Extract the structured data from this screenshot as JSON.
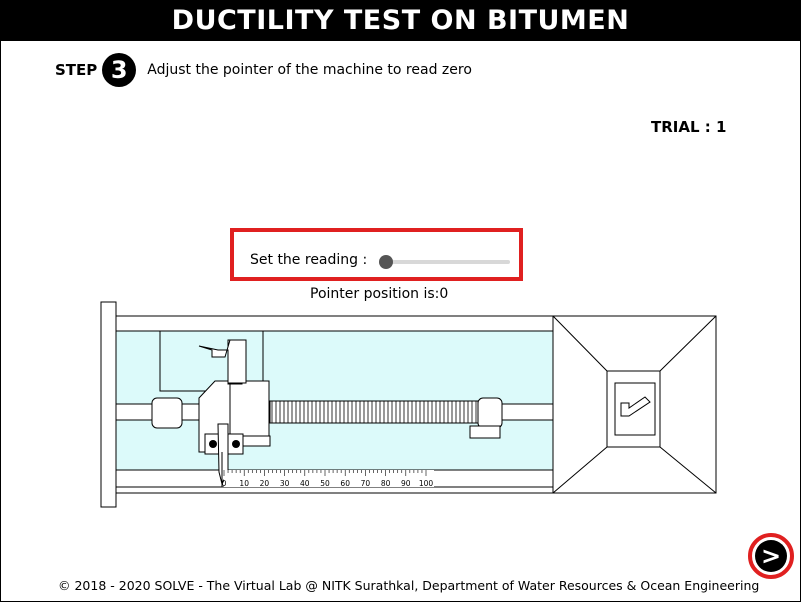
{
  "header": {
    "title": "DUCTILITY TEST ON BITUMEN"
  },
  "step": {
    "label": "STEP",
    "number": "3",
    "instruction": "Adjust the pointer of the machine to read zero"
  },
  "trial": {
    "label": "TRIAL : 1"
  },
  "reading": {
    "label": "Set the reading :",
    "slider_value": 0,
    "slider_min": 0,
    "slider_max": 100
  },
  "pointer": {
    "text": "Pointer position is:0"
  },
  "scale": {
    "ticks": [
      "0",
      "10",
      "20",
      "30",
      "40",
      "50",
      "60",
      "70",
      "80",
      "90",
      "100"
    ]
  },
  "footer": {
    "text": "© 2018 - 2020 SOLVE - The Virtual Lab @ NITK Surathkal, Department of Water Resources & Ocean Engineering"
  },
  "next": {
    "glyph": ">"
  },
  "colors": {
    "water": "#dcfafa",
    "accent_red": "#e02020",
    "header_bg": "#000000"
  }
}
